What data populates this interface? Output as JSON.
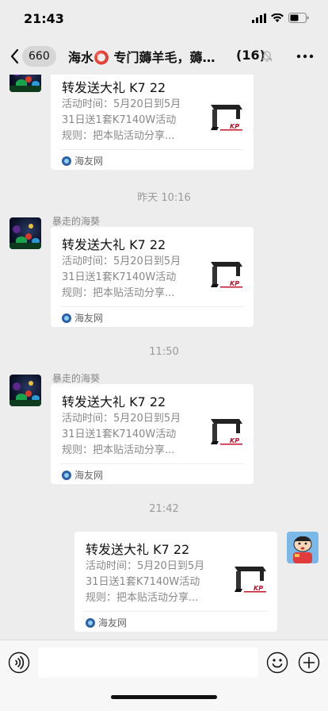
{
  "status_bar": {
    "time": "21:43"
  },
  "nav": {
    "unread_count": "660",
    "title": "海水⭕ 专门薅羊毛，薅…",
    "member_count": "(16)"
  },
  "messages": [
    {
      "sender": "",
      "card": {
        "title": "转发送大礼 K7 22",
        "desc_lines": [
          "活动时间：5月20日到5月",
          "31日送1套K7140W活动",
          "规则：把本贴活动分享..."
        ],
        "source": "海友网"
      }
    },
    {
      "time": "昨天 10:16",
      "sender": "暴走的海葵",
      "card": {
        "title": "转发送大礼 K7 22",
        "desc_lines": [
          "活动时间：5月20日到5月",
          "31日送1套K7140W活动",
          "规则：把本贴活动分享..."
        ],
        "source": "海友网"
      }
    },
    {
      "time": "11:50",
      "sender": "暴走的海葵",
      "card": {
        "title": "转发送大礼 K7 22",
        "desc_lines": [
          "活动时间：5月20日到5月",
          "31日送1套K7140W活动",
          "规则：把本贴活动分享..."
        ],
        "source": "海友网"
      }
    },
    {
      "time": "21:42",
      "sender": "",
      "card": {
        "title": "转发送大礼 K7 22",
        "desc_lines": [
          "活动时间：5月20日到5月",
          "31日送1套K7140W活动",
          "规则：把本贴活动分享..."
        ],
        "source": "海友网"
      }
    }
  ],
  "input": {
    "placeholder": ""
  },
  "colors": {
    "background": "#ededed",
    "card": "#ffffff",
    "meta_text": "#888888"
  },
  "icons": [
    "signal-icon",
    "wifi-icon",
    "battery-icon",
    "back-chevron-icon",
    "mute-bell-icon",
    "more-icon",
    "voice-icon",
    "emoji-icon",
    "plus-icon",
    "source-icon",
    "lamp-thumbnail-icon"
  ]
}
